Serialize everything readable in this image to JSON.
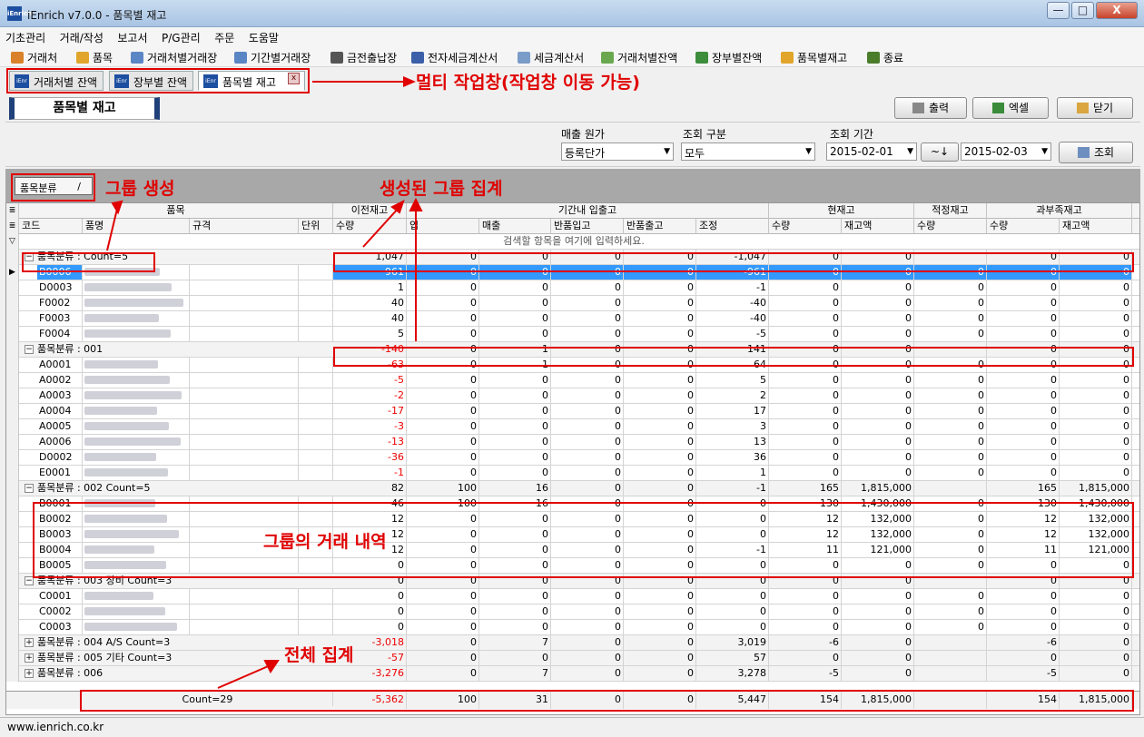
{
  "window": {
    "title": "iEnrich v7.0.0 - 품목별 재고",
    "icon_text": "iEnrich",
    "minimize": "—",
    "maximize": "□",
    "close": "X"
  },
  "menu": [
    "기초관리",
    "거래/작성",
    "보고서",
    "P/G관리",
    "주문",
    "도움말"
  ],
  "toolbar": [
    {
      "label": "거래처",
      "icon": "people-icon",
      "color": "#d9822b"
    },
    {
      "label": "품목",
      "icon": "box-icon",
      "color": "#e0a52a"
    },
    {
      "label": "거래처별거래장",
      "icon": "ledger-icon",
      "color": "#5b86c5"
    },
    {
      "label": "기간별거래장",
      "icon": "ledger-icon",
      "color": "#5b86c5"
    },
    {
      "label": "금전출납장",
      "icon": "book-icon",
      "color": "#555555"
    },
    {
      "label": "전자세금계산서",
      "icon": "invoice-icon",
      "color": "#3b5fa8"
    },
    {
      "label": "세금계산서",
      "icon": "document-icon",
      "color": "#7a9cc8"
    },
    {
      "label": "거래처별잔액",
      "icon": "pencil-icon",
      "color": "#6aa84f"
    },
    {
      "label": "장부별잔액",
      "icon": "money-icon",
      "color": "#3c8d3c"
    },
    {
      "label": "품목별재고",
      "icon": "box-icon",
      "color": "#e0a52a"
    },
    {
      "label": "종료",
      "icon": "exit-icon",
      "color": "#4a7c2a"
    }
  ],
  "tabs": [
    {
      "label": "거래처별 잔액",
      "icon_text": "iEnr",
      "active": false
    },
    {
      "label": "장부별 잔액",
      "icon_text": "iEnr",
      "active": false
    },
    {
      "label": "품목별 재고",
      "icon_text": "iEnr",
      "active": true
    }
  ],
  "tab_close": "x",
  "annotations": {
    "multi_tab": "멀티 작업창(작업창 이동 가능)",
    "group_create": "그룹 생성",
    "group_total": "생성된 그룹 집계",
    "group_detail": "그룹의 거래 내역",
    "grand_total": "전체 집계"
  },
  "page_title": "품목별 재고",
  "buttons": {
    "print": "출력",
    "excel": "엑셀",
    "close": "닫기",
    "query": "조회",
    "date_swap": "~↓"
  },
  "filters": {
    "cost": {
      "label": "매출 원가",
      "value": "등록단가"
    },
    "query_type": {
      "label": "조회 구분",
      "value": "모두"
    },
    "period": {
      "label": "조회 기간",
      "from": "2015-02-01",
      "to": "2015-02-03"
    }
  },
  "group_chip": {
    "label": "품목분류",
    "sort": "/"
  },
  "grid": {
    "band_headers": [
      "품목",
      "이전재고",
      "기간내 입출고",
      "현재고",
      "적정재고",
      "과부족재고"
    ],
    "columns": [
      "코드",
      "품명",
      "규격",
      "단위",
      "수량",
      "입",
      "매출",
      "반품입고",
      "반품출고",
      "조정",
      "수량",
      "재고액",
      "수량",
      "수량",
      "재고액"
    ],
    "filter_hint": "검색할 항목을 여기에 입력하세요.",
    "rows": [
      {
        "type": "group",
        "label": "품목분류 :   Count=5",
        "exp": "−",
        "vals": [
          "1,047",
          "0",
          "0",
          "0",
          "0",
          "-1,047",
          "0",
          "0",
          "",
          "0",
          "0"
        ]
      },
      {
        "type": "item",
        "code": "B0006",
        "sel": true,
        "vals": [
          "961",
          "0",
          "0",
          "0",
          "0",
          "-961",
          "0",
          "0",
          "0",
          "0",
          "0"
        ]
      },
      {
        "type": "item",
        "code": "D0003",
        "vals": [
          "1",
          "0",
          "0",
          "0",
          "0",
          "-1",
          "0",
          "0",
          "0",
          "0",
          "0"
        ]
      },
      {
        "type": "item",
        "code": "F0002",
        "vals": [
          "40",
          "0",
          "0",
          "0",
          "0",
          "-40",
          "0",
          "0",
          "0",
          "0",
          "0"
        ]
      },
      {
        "type": "item",
        "code": "F0003",
        "vals": [
          "40",
          "0",
          "0",
          "0",
          "0",
          "-40",
          "0",
          "0",
          "0",
          "0",
          "0"
        ]
      },
      {
        "type": "item",
        "code": "F0004",
        "vals": [
          "5",
          "0",
          "0",
          "0",
          "0",
          "-5",
          "0",
          "0",
          "0",
          "0",
          "0"
        ]
      },
      {
        "type": "group",
        "label": "품목분류 : 001",
        "exp": "−",
        "vals": [
          "-140",
          "0",
          "1",
          "0",
          "0",
          "141",
          "0",
          "0",
          "",
          "0",
          "0"
        ]
      },
      {
        "type": "item",
        "code": "A0001",
        "vals": [
          "-63",
          "0",
          "1",
          "0",
          "0",
          "64",
          "0",
          "0",
          "0",
          "0",
          "0"
        ]
      },
      {
        "type": "item",
        "code": "A0002",
        "vals": [
          "-5",
          "0",
          "0",
          "0",
          "0",
          "5",
          "0",
          "0",
          "0",
          "0",
          "0"
        ]
      },
      {
        "type": "item",
        "code": "A0003",
        "vals": [
          "-2",
          "0",
          "0",
          "0",
          "0",
          "2",
          "0",
          "0",
          "0",
          "0",
          "0"
        ]
      },
      {
        "type": "item",
        "code": "A0004",
        "vals": [
          "-17",
          "0",
          "0",
          "0",
          "0",
          "17",
          "0",
          "0",
          "0",
          "0",
          "0"
        ]
      },
      {
        "type": "item",
        "code": "A0005",
        "vals": [
          "-3",
          "0",
          "0",
          "0",
          "0",
          "3",
          "0",
          "0",
          "0",
          "0",
          "0"
        ]
      },
      {
        "type": "item",
        "code": "A0006",
        "vals": [
          "-13",
          "0",
          "0",
          "0",
          "0",
          "13",
          "0",
          "0",
          "0",
          "0",
          "0"
        ]
      },
      {
        "type": "item",
        "code": "D0002",
        "vals": [
          "-36",
          "0",
          "0",
          "0",
          "0",
          "36",
          "0",
          "0",
          "0",
          "0",
          "0"
        ]
      },
      {
        "type": "item",
        "code": "E0001",
        "vals": [
          "-1",
          "0",
          "0",
          "0",
          "0",
          "1",
          "0",
          "0",
          "0",
          "0",
          "0"
        ]
      },
      {
        "type": "group",
        "label": "품목분류 : 002        Count=5",
        "exp": "−",
        "vals": [
          "82",
          "100",
          "16",
          "0",
          "0",
          "-1",
          "165",
          "1,815,000",
          "",
          "165",
          "1,815,000"
        ]
      },
      {
        "type": "item",
        "code": "B0001",
        "vals": [
          "46",
          "100",
          "16",
          "0",
          "0",
          "0",
          "130",
          "1,430,000",
          "0",
          "130",
          "1,430,000"
        ]
      },
      {
        "type": "item",
        "code": "B0002",
        "vals": [
          "12",
          "0",
          "0",
          "0",
          "0",
          "0",
          "12",
          "132,000",
          "0",
          "12",
          "132,000"
        ]
      },
      {
        "type": "item",
        "code": "B0003",
        "vals": [
          "12",
          "0",
          "0",
          "0",
          "0",
          "0",
          "12",
          "132,000",
          "0",
          "12",
          "132,000"
        ]
      },
      {
        "type": "item",
        "code": "B0004",
        "vals": [
          "12",
          "0",
          "0",
          "0",
          "0",
          "-1",
          "11",
          "121,000",
          "0",
          "11",
          "121,000"
        ]
      },
      {
        "type": "item",
        "code": "B0005",
        "vals": [
          "0",
          "0",
          "0",
          "0",
          "0",
          "0",
          "0",
          "0",
          "0",
          "0",
          "0"
        ]
      },
      {
        "type": "group",
        "label": "품목분류 : 003 장비 Count=3",
        "exp": "−",
        "vals": [
          "0",
          "0",
          "0",
          "0",
          "0",
          "0",
          "0",
          "0",
          "",
          "0",
          "0"
        ]
      },
      {
        "type": "item",
        "code": "C0001",
        "vals": [
          "0",
          "0",
          "0",
          "0",
          "0",
          "0",
          "0",
          "0",
          "0",
          "0",
          "0"
        ]
      },
      {
        "type": "item",
        "code": "C0002",
        "vals": [
          "0",
          "0",
          "0",
          "0",
          "0",
          "0",
          "0",
          "0",
          "0",
          "0",
          "0"
        ]
      },
      {
        "type": "item",
        "code": "C0003",
        "vals": [
          "0",
          "0",
          "0",
          "0",
          "0",
          "0",
          "0",
          "0",
          "0",
          "0",
          "0"
        ]
      },
      {
        "type": "group",
        "label": "품목분류 : 004 A/S Count=3",
        "exp": "+",
        "vals": [
          "-3,018",
          "0",
          "7",
          "0",
          "0",
          "3,019",
          "-6",
          "0",
          "",
          "-6",
          "0"
        ]
      },
      {
        "type": "group",
        "label": "품목분류 : 005 기타 Count=3",
        "exp": "+",
        "vals": [
          "-57",
          "0",
          "0",
          "0",
          "0",
          "57",
          "0",
          "0",
          "",
          "0",
          "0"
        ]
      },
      {
        "type": "group",
        "label": "품목분류 : 006",
        "exp": "+",
        "vals": [
          "-3,276",
          "0",
          "7",
          "0",
          "0",
          "3,278",
          "-5",
          "0",
          "",
          "-5",
          "0"
        ]
      }
    ],
    "footer": {
      "count": "Count=29",
      "vals": [
        "-5,362",
        "100",
        "31",
        "0",
        "0",
        "5,447",
        "154",
        "1,815,000",
        "",
        "154",
        "1,815,000"
      ]
    }
  },
  "status": "www.ienrich.co.kr",
  "colors": {
    "accent": "#20407a",
    "highlight": "#e00000",
    "selection": "#3399ff"
  }
}
